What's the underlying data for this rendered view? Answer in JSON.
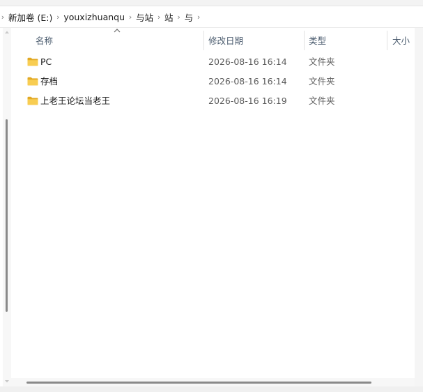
{
  "breadcrumb": {
    "items": [
      {
        "label": "新加卷 (E:)"
      },
      {
        "label": "youxizhuanqu"
      },
      {
        "label": "与站"
      },
      {
        "label": "站"
      },
      {
        "label": "与"
      }
    ]
  },
  "columns": {
    "name": "名称",
    "date": "修改日期",
    "type": "类型",
    "size": "大小"
  },
  "files": [
    {
      "name": "PC",
      "date": "2026-08-16 16:14",
      "type": "文件夹",
      "icon": "folder-icon"
    },
    {
      "name": "存档",
      "date": "2026-08-16 16:14",
      "type": "文件夹",
      "icon": "folder-icon"
    },
    {
      "name": "上老王论坛当老王",
      "date": "2026-08-16 16:19",
      "type": "文件夹",
      "icon": "folder-icon"
    }
  ],
  "colors": {
    "folder": "#f5c542",
    "folder_dark": "#e2a924",
    "header_text": "#4a5b6e",
    "scroll_thumb": "#8a8a8a"
  }
}
